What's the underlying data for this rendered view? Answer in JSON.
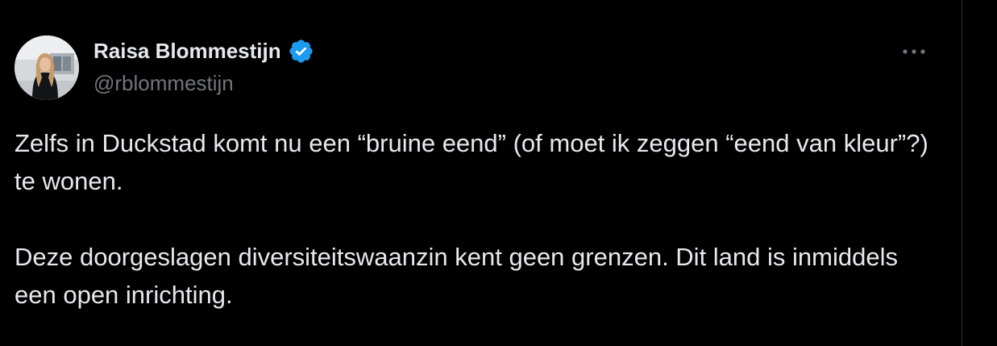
{
  "author": {
    "display_name": "Raisa Blommestijn",
    "handle": "@rblommestijn",
    "verified": true,
    "verified_color": "#1d9bf0"
  },
  "tweet": {
    "paragraphs": [
      "Zelfs in Duckstad komt nu een “bruine eend” (of moet ik zeggen “eend van kleur”?) te wonen.",
      "Deze doorgeslagen diversiteitswaanzin kent geen grenzen. Dit land is inmiddels een open inrichting."
    ]
  },
  "icons": {
    "more": "more-horizontal-icon",
    "verified": "verified-badge-icon"
  },
  "colors": {
    "background": "#000000",
    "text": "#e7e9ea",
    "secondary_text": "#71767b",
    "divider": "#2f3336"
  }
}
